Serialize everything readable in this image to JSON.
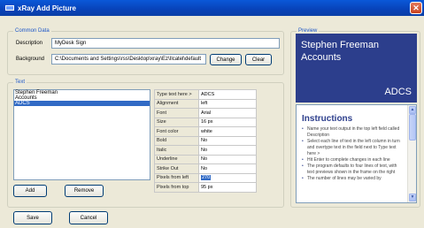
{
  "window": {
    "title": "xRay Add Picture",
    "close_label": "✕"
  },
  "common": {
    "group_label": "Common Data",
    "description_label": "Description",
    "description_value": "MyDesk Sign",
    "background_label": "Background",
    "background_value": "C:\\Documents and Settings\\rss\\Desktop\\xray\\Ez\\Ilcatel\\default",
    "change_label": "Change",
    "clear_label": "Clear"
  },
  "text": {
    "group_label": "Text",
    "items": [
      "Stephen Freeman",
      "Accounts",
      "ADCS"
    ],
    "selected_index": 2,
    "add_label": "Add",
    "remove_label": "Remove",
    "properties": [
      {
        "key": "Type text here >",
        "value": "ADCS"
      },
      {
        "key": "Alignment",
        "value": "left"
      },
      {
        "key": "Font",
        "value": "Arial"
      },
      {
        "key": "Size",
        "value": "16 px"
      },
      {
        "key": "Font color",
        "value": "white"
      },
      {
        "key": "Bold",
        "value": "No"
      },
      {
        "key": "Italic",
        "value": "No"
      },
      {
        "key": "Underline",
        "value": "No"
      },
      {
        "key": "Strike Out",
        "value": "No"
      },
      {
        "key": "Pixels from left",
        "value": "270"
      },
      {
        "key": "Pixels from top",
        "value": "95 px"
      }
    ]
  },
  "preview": {
    "group_label": "Preview",
    "line1": "Stephen Freeman",
    "line2": "Accounts",
    "code": "ADCS",
    "bg_color": "#2c3e8c"
  },
  "instructions": {
    "title": "Instructions",
    "items": [
      "Name your text output in the top left field called Description",
      "Select each line of text in the left column in turn and overtype text in the field next to Type text here >",
      "Hit Enter to complete changes in each line",
      "The program defaults to four lines of text, with text previews shown in the frame on the right",
      "The number of lines may be varied by"
    ]
  },
  "footer": {
    "save_label": "Save",
    "cancel_label": "Cancel"
  }
}
